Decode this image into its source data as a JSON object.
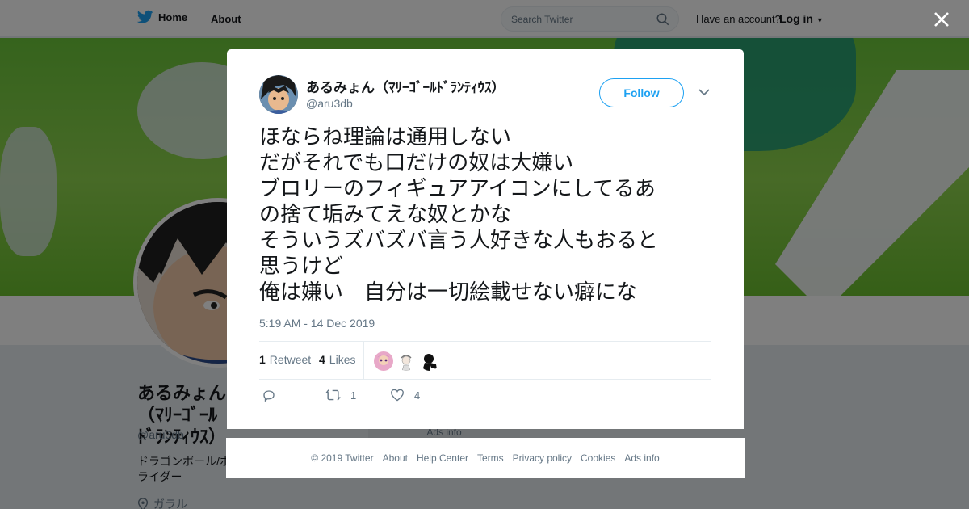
{
  "topbar": {
    "home_label": "Home",
    "about_label": "About",
    "search_placeholder": "Search Twitter",
    "have_account": "Have an account?",
    "login_label": "Log in"
  },
  "profile": {
    "name": "あるみょん（ﾏﾘｰｺﾞｰﾙﾄﾞﾗﾝﾃｨｳｽ）",
    "handle": "@aru3db",
    "bio": "ドラゴンボール/ホライダー",
    "location": "ガラル"
  },
  "background_ads_info": "Ads info",
  "tweet": {
    "author_name": "あるみょん（ﾏﾘｰｺﾞｰﾙﾄﾞﾗﾝﾃｨｳｽ）",
    "author_handle": "@aru3db",
    "follow_label": "Follow",
    "lines": [
      "ほならね理論は通用しない",
      "だがそれでも口だけの奴は大嫌い",
      "ブロリーのフィギュアアイコンにしてるあ",
      "の捨て垢みてえな奴とかな",
      "そういうズバズバ言う人好きな人もおると",
      "思うけど",
      "俺は嫌い　自分は一切絵載せない癖にな"
    ],
    "timestamp": "5:19 AM - 14 Dec 2019",
    "retweet_count": "1",
    "retweet_label": "Retweet",
    "like_count": "4",
    "like_label": "Likes",
    "action_retweet_count": "1",
    "action_like_count": "4"
  },
  "footer": {
    "copyright": "© 2019 Twitter",
    "about": "About",
    "help": "Help Center",
    "terms": "Terms",
    "privacy": "Privacy policy",
    "cookies": "Cookies",
    "ads": "Ads info"
  },
  "colors": {
    "brand_blue": "#1da1f2",
    "text_primary": "#14171a",
    "text_secondary": "#657786",
    "border": "#e6ecf0"
  }
}
